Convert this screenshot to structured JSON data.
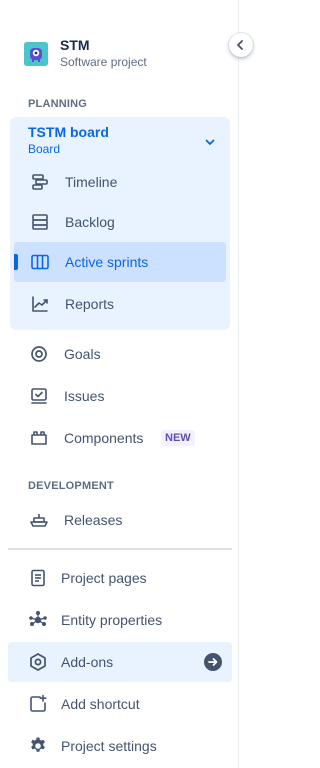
{
  "project": {
    "name": "STM",
    "type": "Software project",
    "avatar_color": "#4bc4ce"
  },
  "planning": {
    "heading": "PLANNING",
    "board": {
      "title": "TSTM board",
      "subtitle": "Board"
    },
    "board_items": [
      {
        "label": "Timeline",
        "icon": "timeline-icon"
      },
      {
        "label": "Backlog",
        "icon": "backlog-icon"
      },
      {
        "label": "Active sprints",
        "icon": "board-columns-icon",
        "active": true
      },
      {
        "label": "Reports",
        "icon": "reports-chart-icon"
      }
    ],
    "items": [
      {
        "label": "Goals",
        "icon": "goals-target-icon"
      },
      {
        "label": "Issues",
        "icon": "issues-icon"
      },
      {
        "label": "Components",
        "icon": "components-icon",
        "badge": "NEW"
      }
    ]
  },
  "development": {
    "heading": "DEVELOPMENT",
    "items": [
      {
        "label": "Releases",
        "icon": "releases-ship-icon"
      }
    ]
  },
  "bottom": {
    "items": [
      {
        "label": "Project pages",
        "icon": "page-icon"
      },
      {
        "label": "Entity properties",
        "icon": "entity-properties-icon"
      },
      {
        "label": "Add-ons",
        "icon": "addons-hexagon-icon",
        "hover": true
      },
      {
        "label": "Add shortcut",
        "icon": "add-shortcut-icon"
      },
      {
        "label": "Project settings",
        "icon": "settings-gear-icon"
      }
    ]
  },
  "colors": {
    "accent": "#0c66e4",
    "active_bg": "#cce0ff",
    "group_bg": "#e9f2ff",
    "text": "#44546f",
    "badge_text": "#5e4db2",
    "badge_bg": "#f3f0ff"
  }
}
